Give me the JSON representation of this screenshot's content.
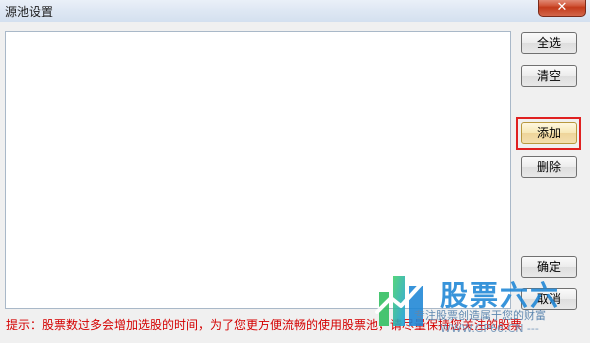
{
  "window": {
    "title": "源池设置",
    "close_label": "✕"
  },
  "buttons": {
    "select_all": "全选",
    "clear": "清空",
    "add": "添加",
    "delete": "删除",
    "ok": "确定",
    "cancel": "取消"
  },
  "tip": "提示：股票数过多会增加选股的时间，为了您更方便流畅的使用股票池，请尽量保持您关注的股票",
  "watermark": {
    "brand": "股票六六",
    "slogan": "专注股票创造属于您的财富",
    "url": "WWW.GP66.CN ---"
  },
  "colors": {
    "highlight": "#e02020",
    "tip_text": "#d40000",
    "brand": "#1d86d6"
  }
}
